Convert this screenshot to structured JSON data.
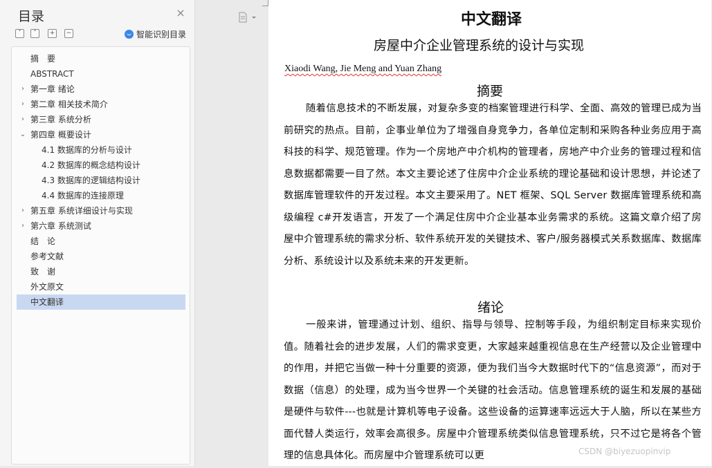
{
  "toc": {
    "title": "目录",
    "close_symbol": "×",
    "tools": [
      "˅",
      "˄",
      "+",
      "−"
    ],
    "smart_toc_label": "智能识别目录",
    "items": [
      {
        "label": "摘　要",
        "level": 1,
        "arrow": "",
        "selected": false
      },
      {
        "label": "ABSTRACT",
        "level": 1,
        "arrow": "",
        "selected": false
      },
      {
        "label": "第一章 绪论",
        "level": 1,
        "arrow": "›",
        "selected": false
      },
      {
        "label": "第二章 相关技术简介",
        "level": 1,
        "arrow": "›",
        "selected": false
      },
      {
        "label": "第三章 系统分析",
        "level": 1,
        "arrow": "›",
        "selected": false
      },
      {
        "label": "第四章 概要设计",
        "level": 1,
        "arrow": "⌄",
        "selected": false
      },
      {
        "label": "4.1 数据库的分析与设计",
        "level": 2,
        "arrow": "",
        "selected": false
      },
      {
        "label": "4.2 数据库的概念结构设计",
        "level": 2,
        "arrow": "",
        "selected": false
      },
      {
        "label": "4.3 数据库的逻辑结构设计",
        "level": 2,
        "arrow": "",
        "selected": false
      },
      {
        "label": "4.4 数据库的连接原理",
        "level": 2,
        "arrow": "",
        "selected": false
      },
      {
        "label": "第五章 系统详细设计与实现",
        "level": 1,
        "arrow": "›",
        "selected": false
      },
      {
        "label": "第六章 系统测试",
        "level": 1,
        "arrow": "›",
        "selected": false
      },
      {
        "label": "结　论",
        "level": 1,
        "arrow": "",
        "selected": false
      },
      {
        "label": "参考文献",
        "level": 1,
        "arrow": "",
        "selected": false
      },
      {
        "label": "致　谢",
        "level": 1,
        "arrow": "",
        "selected": false
      },
      {
        "label": "外文原文",
        "level": 1,
        "arrow": "",
        "selected": false
      },
      {
        "label": "中文翻译",
        "level": 1,
        "arrow": "",
        "selected": true
      }
    ]
  },
  "document": {
    "title": "中文翻译",
    "subtitle": "房屋中介企业管理系统的设计与实现",
    "authors": "Xiaodi Wang, Jie Meng and Yuan Zhang",
    "abstract_heading": "摘要",
    "abstract_text": "随着信息技术的不断发展，对复杂多变的档案管理进行科学、全面、高效的管理已成为当前研究的热点。目前，企事业单位为了增强自身竞争力，各单位定制和采购各种业务应用于高科技的科学、规范管理。作为一个房地产中介机构的管理者，房地产中介业务的管理过程和信息数据都需要一目了然。本文主要论述了住房中介企业系统的理论基础和设计思想，并论述了数据库管理软件的开发过程。本文主要采用了。NET 框架、SQL Server 数据库管理系统和高级编程 c#开发语言，开发了一个满足住房中介企业基本业务需求的系统。这篇文章介绍了房屋中介管理系统的需求分析、软件系统开发的关键技术、客户/服务器模式关系数据库、数据库分析、系统设计以及系统未来的开发更新。",
    "intro_heading": "绪论",
    "intro_text": "一般来讲，管理通过计划、组织、指导与领导、控制等手段，为组织制定目标来实现价值。随着社会的进步发展，人们的需求变更，大家越来越重视信息在生产经营以及企业管理中的作用，并把它当做一种十分重要的资源，便为我们当今大数据时代下的“信息资源”，而对于数据（信息）的处理，成为当今世界一个关键的社会活动。信息管理系统的诞生和发展的基础是硬件与软件---也就是计算机等电子设备。这些设备的运算速率远远大于人脑，所以在某些方面代替人类运行，效率会高很多。房屋中介管理系统类似信息管理系统，只不过它是将各个管理的信息具体化。而房屋中介管理系统可以更"
  },
  "watermark": "CSDN @biyezuopinvip",
  "colors": {
    "selected_bg": "#c9d8f1",
    "accent": "#3a86e8",
    "spellcheck": "#dd3333"
  }
}
